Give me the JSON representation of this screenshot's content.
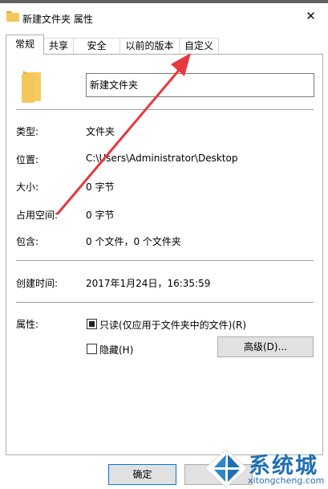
{
  "window": {
    "title": "新建文件夹 属性",
    "close_glyph": "✕"
  },
  "tabs": [
    {
      "label": "常规",
      "active": true
    },
    {
      "label": "共享",
      "active": false
    },
    {
      "label": "安全",
      "active": false
    },
    {
      "label": "以前的版本",
      "active": false
    },
    {
      "label": "自定义",
      "active": false
    }
  ],
  "general": {
    "name_value": "新建文件夹",
    "rows": [
      {
        "label": "类型:",
        "value": "文件夹"
      },
      {
        "label": "位置:",
        "value": "C:\\Users\\Administrator\\Desktop"
      },
      {
        "label": "大小:",
        "value": "0 字节"
      },
      {
        "label": "占用空间:",
        "value": "0 字节"
      },
      {
        "label": "包含:",
        "value": "0 个文件，0 个文件夹"
      },
      {
        "label": "创建时间:",
        "value": "2017年1月24日，16:35:59"
      }
    ],
    "attributes": {
      "label": "属性:",
      "readonly_label": "只读(仅应用于文件夹中的文件)(R)",
      "readonly_state": "indeterminate",
      "hidden_label": "隐藏(H)",
      "hidden_checked": false,
      "advanced_button": "高级(D)..."
    }
  },
  "footer": {
    "ok_label": "确定",
    "cancel_label_partial": "取"
  },
  "watermark": {
    "text": "系统城",
    "url": "xitongcheng.com"
  },
  "colors": {
    "annotation_arrow": "#e8383d",
    "folder": "#f5c75a",
    "watermark": "#1f6fb4"
  },
  "icons": {
    "title": "folder-icon",
    "main": "folder-icon",
    "watermark_logo": "windows-logo-icon"
  }
}
